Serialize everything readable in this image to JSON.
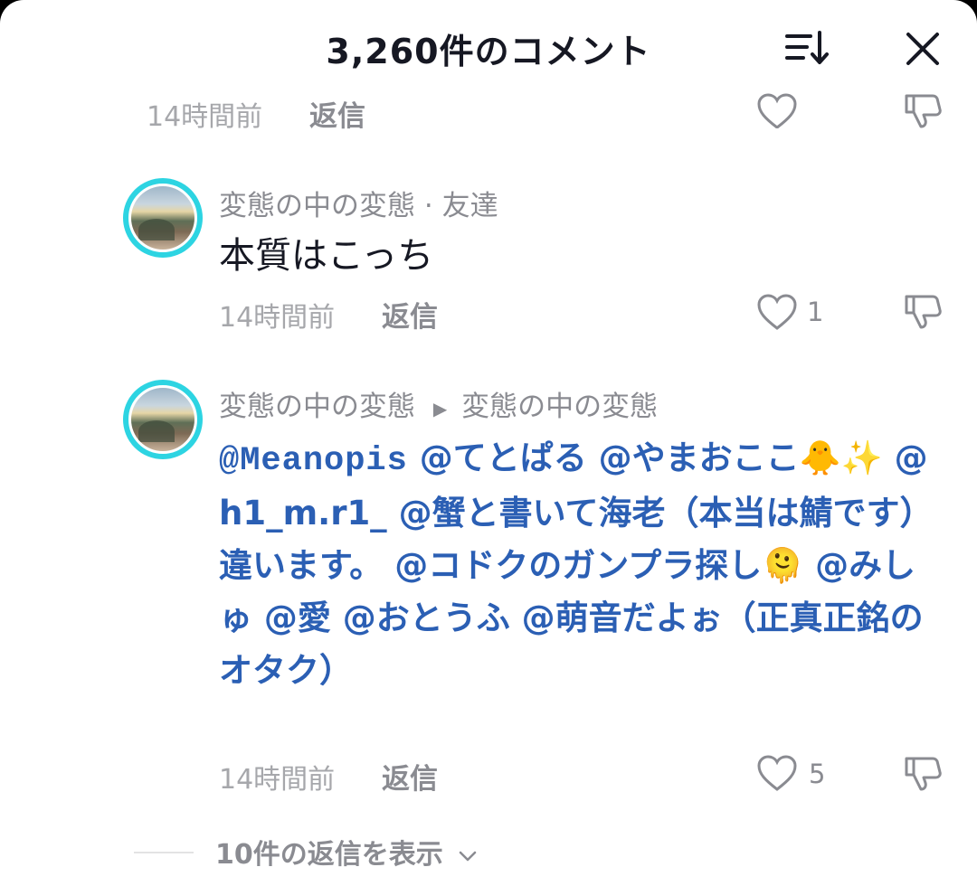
{
  "header": {
    "title": "3,260件のコメント",
    "sort_icon": "sort-list-icon",
    "close_icon": "close-icon"
  },
  "comments": [
    {
      "time": "14時間前",
      "reply_label": "返信"
    },
    {
      "username": "変態の中の変態",
      "separator": "·",
      "badge": "友達",
      "text": "本質はこっち",
      "time": "14時間前",
      "reply_label": "返信",
      "likes": "1"
    },
    {
      "username": "変態の中の変態",
      "reply_to": "変態の中の変態",
      "mentions": {
        "m1": "@Meanopis",
        "m2": "@てとぱる",
        "m3": "@やまおここ🐥✨",
        "m4": "@h1_m.r1_",
        "m5": "@蟹と書いて海老（本当は鯖です）違います。",
        "m6": "@コドクのガンプラ探し🫠",
        "m7": "@みしゅ",
        "m8": "@愛",
        "m9": "@おとうふ",
        "m10": "@萌音だよぉ（正真正銘のオタク）"
      },
      "time": "14時間前",
      "reply_label": "返信",
      "likes": "5",
      "view_replies": "10件の返信を表示"
    }
  ],
  "colors": {
    "mention": "#2b5fb4",
    "meta": "#8a8b91",
    "avatar_ring": "#2dd4e2"
  }
}
